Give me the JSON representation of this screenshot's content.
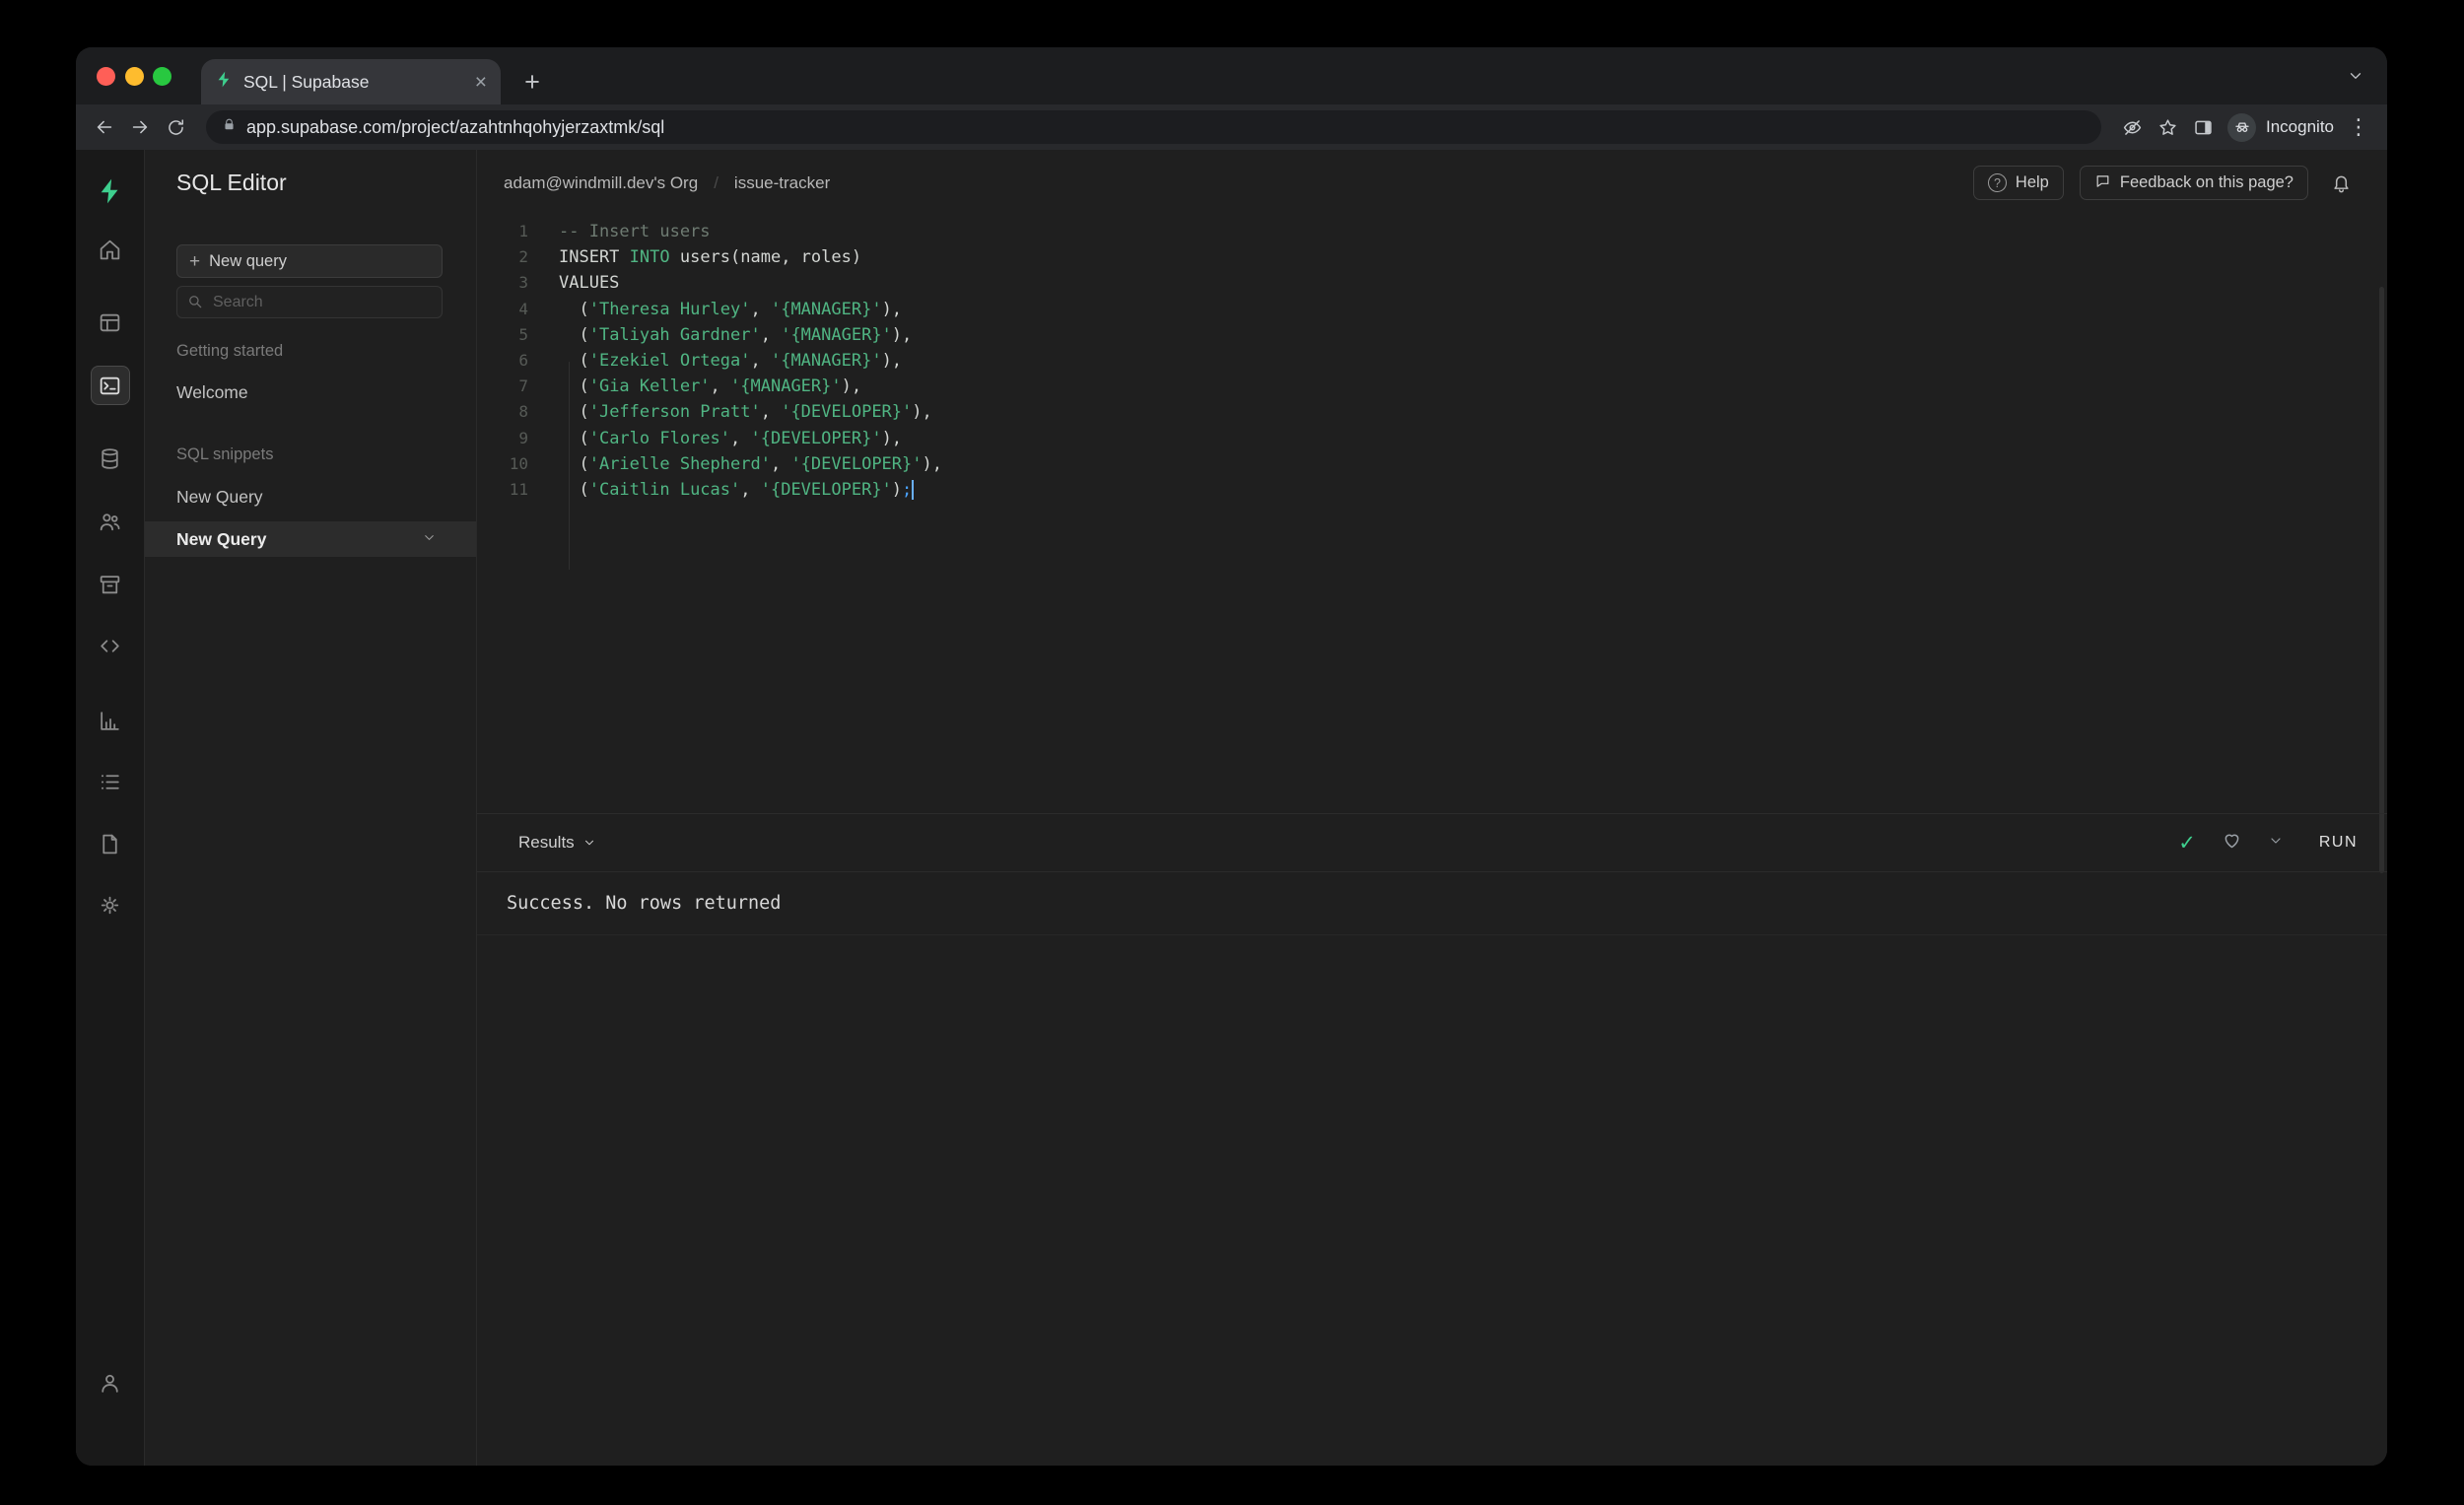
{
  "browser": {
    "tab_title": "SQL | Supabase",
    "url": "app.supabase.com/project/azahtnhqohyjerzaxtmk/sql",
    "incognito_label": "Incognito"
  },
  "icon_rail": {
    "icons": [
      "supabase-logo",
      "home",
      "table-editor",
      "sql-editor",
      "database",
      "authentication",
      "storage",
      "edge-functions",
      "reports",
      "logs",
      "api-docs",
      "project-settings",
      "account"
    ]
  },
  "sidebar": {
    "title": "SQL Editor",
    "new_query_button": "New query",
    "search_placeholder": "Search",
    "getting_started_label": "Getting started",
    "welcome_item": "Welcome",
    "sql_snippets_label": "SQL snippets",
    "query_item_1": "New Query",
    "query_item_2": "New Query"
  },
  "header": {
    "org": "adam@windmill.dev's Org",
    "separator": "/",
    "project": "issue-tracker",
    "help_button": "Help",
    "feedback_button": "Feedback on this page?"
  },
  "editor": {
    "lines": [
      [
        [
          "cm",
          "-- Insert users"
        ]
      ],
      [
        [
          "tx",
          "INSERT "
        ],
        [
          "kw",
          "INTO"
        ],
        [
          "tx",
          " users(name, roles)"
        ]
      ],
      [
        [
          "tx",
          "VALUES"
        ]
      ],
      [
        [
          "tx",
          "  ("
        ],
        [
          "st",
          "'Theresa Hurley'"
        ],
        [
          "tx",
          ", "
        ],
        [
          "st",
          "'{MANAGER}'"
        ],
        [
          "tx",
          "),"
        ]
      ],
      [
        [
          "tx",
          "  ("
        ],
        [
          "st",
          "'Taliyah Gardner'"
        ],
        [
          "tx",
          ", "
        ],
        [
          "st",
          "'{MANAGER}'"
        ],
        [
          "tx",
          "),"
        ]
      ],
      [
        [
          "tx",
          "  ("
        ],
        [
          "st",
          "'Ezekiel Ortega'"
        ],
        [
          "tx",
          ", "
        ],
        [
          "st",
          "'{MANAGER}'"
        ],
        [
          "tx",
          "),"
        ]
      ],
      [
        [
          "tx",
          "  ("
        ],
        [
          "st",
          "'Gia Keller'"
        ],
        [
          "tx",
          ", "
        ],
        [
          "st",
          "'{MANAGER}'"
        ],
        [
          "tx",
          "),"
        ]
      ],
      [
        [
          "tx",
          "  ("
        ],
        [
          "st",
          "'Jefferson Pratt'"
        ],
        [
          "tx",
          ", "
        ],
        [
          "st",
          "'{DEVELOPER}'"
        ],
        [
          "tx",
          "),"
        ]
      ],
      [
        [
          "tx",
          "  ("
        ],
        [
          "st",
          "'Carlo Flores'"
        ],
        [
          "tx",
          ", "
        ],
        [
          "st",
          "'{DEVELOPER}'"
        ],
        [
          "tx",
          "),"
        ]
      ],
      [
        [
          "tx",
          "  ("
        ],
        [
          "st",
          "'Arielle Shepherd'"
        ],
        [
          "tx",
          ", "
        ],
        [
          "st",
          "'{DEVELOPER}'"
        ],
        [
          "tx",
          "),"
        ]
      ],
      [
        [
          "tx",
          "  ("
        ],
        [
          "st",
          "'Caitlin Lucas'"
        ],
        [
          "tx",
          ", "
        ],
        [
          "st",
          "'{DEVELOPER}'"
        ],
        [
          "tx",
          ")"
        ],
        [
          "cu",
          ";"
        ]
      ]
    ]
  },
  "results": {
    "label": "Results",
    "run_button": "RUN",
    "output": "Success. No rows returned"
  },
  "colors": {
    "brand_green": "#3ecf8e",
    "code_green": "#50b583",
    "cursor_blue": "#4aa3ff",
    "success_check": "#3ecf8e"
  }
}
